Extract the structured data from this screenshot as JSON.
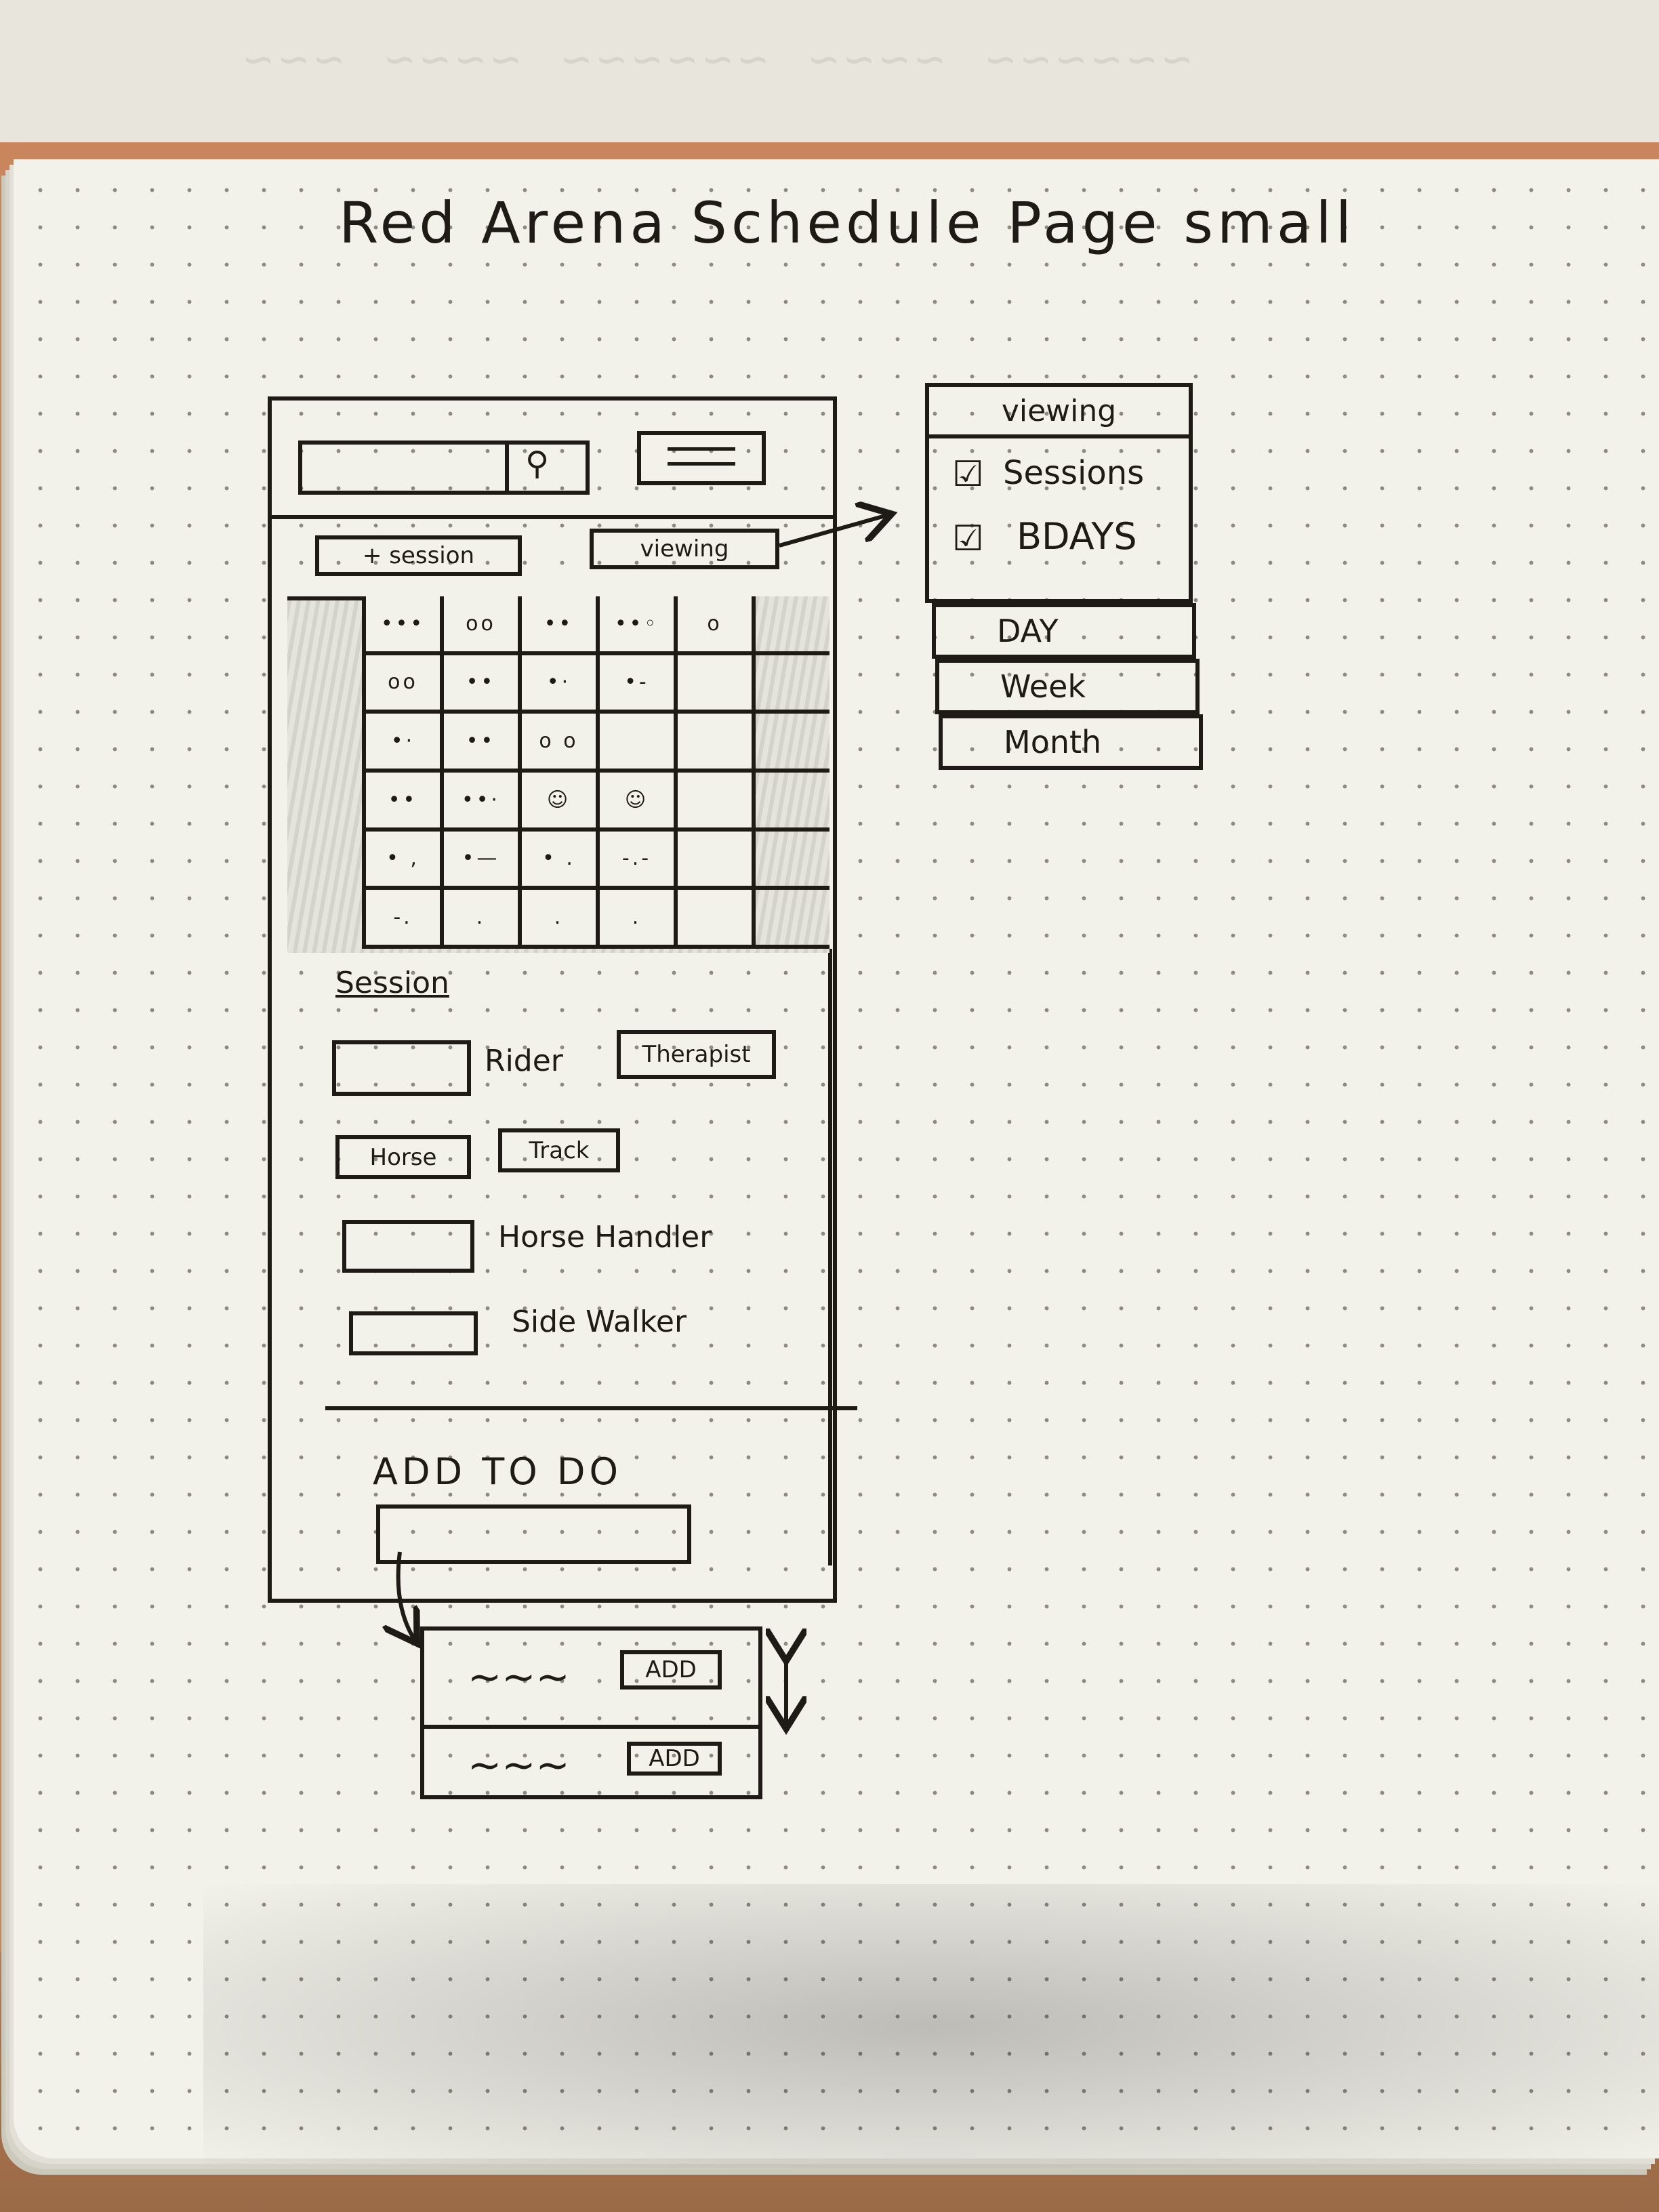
{
  "title": "Red Arena Schedule Page small",
  "toolbar": {
    "search_icon": "search-icon",
    "menu_icon": "hamburger-menu-icon",
    "add_session_label": "+ session",
    "viewing_label": "viewing"
  },
  "calendar": {
    "rows": [
      [
        "•••",
        "oo",
        "••",
        "••◦",
        "o",
        ""
      ],
      [
        "oo",
        "••",
        "•·",
        "•-",
        "",
        ""
      ],
      [
        "•·",
        "••",
        "o o",
        "",
        "",
        ""
      ],
      [
        "••",
        "••·",
        "☺",
        "☺",
        "",
        ""
      ],
      [
        "• ,",
        "•—",
        "• .",
        "-.-",
        "",
        ""
      ],
      [
        "-.",
        ".",
        ".",
        ".",
        "",
        ""
      ]
    ]
  },
  "session_form": {
    "heading": "Session",
    "rider_label": "Rider",
    "therapist_label": "Therapist",
    "horse_label": "Horse",
    "track_label": "Track",
    "horse_handler_label": "Horse Handler",
    "side_walker_label": "Side Walker"
  },
  "todo": {
    "heading": "ADD TO DO",
    "items": [
      {
        "text": "~~~",
        "button": "ADD"
      },
      {
        "text": "~~~",
        "button": "ADD"
      }
    ]
  },
  "viewing_dropdown": {
    "header": "viewing",
    "options": [
      {
        "label": "Sessions",
        "checked": true
      },
      {
        "label": "BDAYS",
        "checked": true
      }
    ],
    "ranges": [
      "DAY",
      "Week",
      "Month"
    ]
  }
}
